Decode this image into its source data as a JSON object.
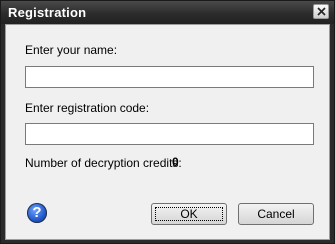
{
  "window": {
    "title": "Registration"
  },
  "form": {
    "name_label": "Enter your name:",
    "name_value": "",
    "code_label": "Enter registration code:",
    "code_value": "",
    "credits_label": "Number of decryption credits:",
    "credits_value": "0"
  },
  "buttons": {
    "ok": "OK",
    "cancel": "Cancel"
  },
  "icons": {
    "help": "?"
  }
}
